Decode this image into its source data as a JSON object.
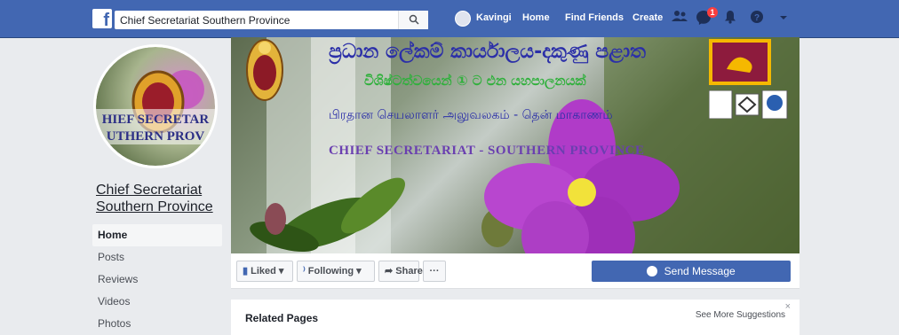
{
  "topbar": {
    "logo": "f",
    "search_value": "Chief Secretariat Southern Province",
    "user_name": "Kavingi",
    "links": {
      "home": "Home",
      "find_friends": "Find Friends",
      "create": "Create"
    },
    "notification_count": "1",
    "icons": [
      "friends-icon",
      "messenger-icon",
      "notifications-icon",
      "help-icon",
      "chevron-down-icon"
    ]
  },
  "profile": {
    "name": "Chief Secretariat Southern Province",
    "logo_text_line1": "HIEF SECRETAR",
    "logo_text_line2": "UTHERN PROV"
  },
  "menu": {
    "items": [
      {
        "label": "Home",
        "active": true
      },
      {
        "label": "Posts"
      },
      {
        "label": "Reviews"
      },
      {
        "label": "Videos"
      },
      {
        "label": "Photos"
      }
    ]
  },
  "cover": {
    "sinhala_title": "ප්‍රධාන ලේකම් කාර්යාලය-දකුණු පළාත",
    "sinhala_subtitle": "විශිෂ්ටත්වයෙන් ① ට එන යහපාලනයක්",
    "tamil_title": "பிரதான செயலாளர் அலுவலகம் - தென் மாகாணம்",
    "english_title": "CHIEF SECRETARIAT - SOUTHERN PROVINCE"
  },
  "actions": {
    "liked": "Liked",
    "following": "Following",
    "share": "Share",
    "more": "···",
    "send_message": "Send Message"
  },
  "related": {
    "title": "Related Pages",
    "see_more": "See More Suggestions",
    "close": "×"
  },
  "colors": {
    "brand_blue": "#4267b2",
    "badge_red": "#fa3e3e",
    "page_bg": "#e9ebee",
    "flower_purple": "#b03bc8"
  }
}
